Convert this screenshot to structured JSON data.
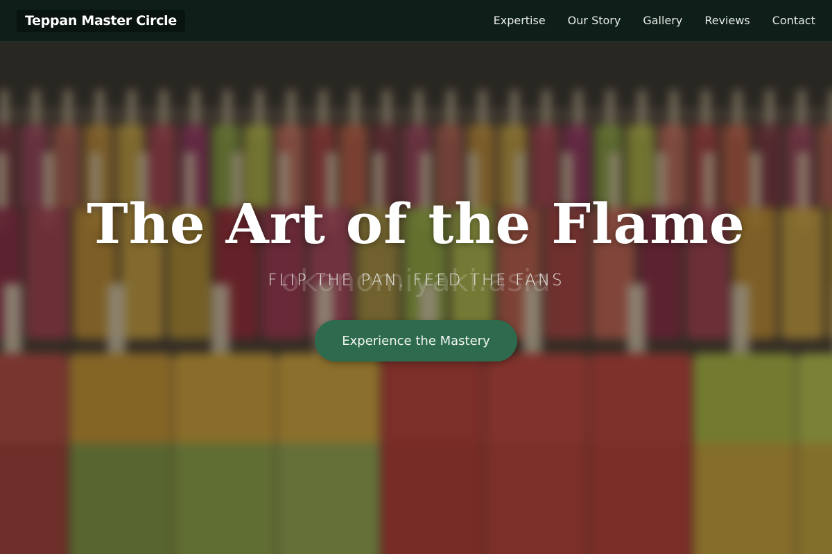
{
  "nav": {
    "brand": "Teppan Master Circle",
    "links": [
      "Expertise",
      "Our Story",
      "Gallery",
      "Reviews",
      "Contact"
    ]
  },
  "hero": {
    "title": "The Art of the Flame",
    "tagline": "FLIP THE PAN, FEED THE FANS",
    "watermark": "okonomiyaki.asia",
    "cta_label": "Experience the Mastery"
  },
  "colors": {
    "nav_background": "#0c1e18",
    "cta_background": "#2e6b4e",
    "title_text": "#ffffff"
  }
}
